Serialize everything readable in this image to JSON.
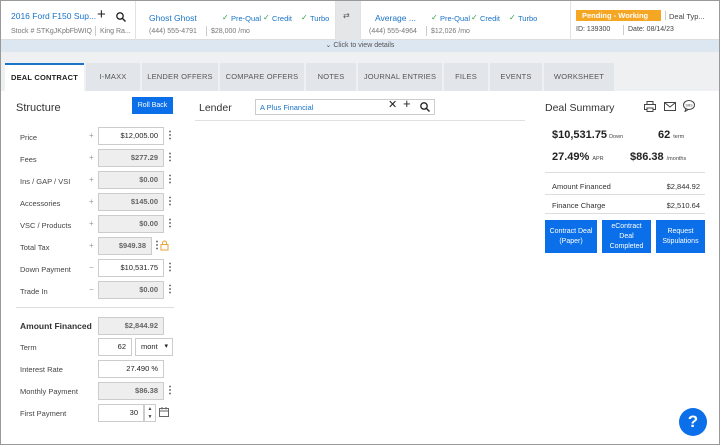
{
  "header": {
    "vehicle": {
      "title": "2016 Ford F150 Sup...",
      "stock": "Stock # STKgJKpbFbWIQ",
      "location": "King Ra..."
    },
    "buyer": {
      "name": "Ghost Ghost",
      "phone": "(444) 555-4791",
      "amount": "$28,000 /mo",
      "prequal": "Pre-Qual",
      "credit": "Credit",
      "turbo": "Turbo"
    },
    "cobuyer": {
      "name": "Average ...",
      "phone": "(444) 555-4964",
      "amount": "$12,026 /mo",
      "prequal": "Pre-Qual",
      "credit": "Credit",
      "turbo": "Turbo"
    },
    "status": {
      "badge": "Pending - Working Lead",
      "type": "Deal Typ...",
      "id": "ID: 139300",
      "date": "Date: 08/14/23"
    },
    "colors": {
      "badge": "#f5a623",
      "accent": "#1a73c8",
      "check": "#2e9e44"
    }
  },
  "view_details": "Click to view details",
  "tabs": [
    "DEAL CONTRACT",
    "I-MAXX",
    "LENDER OFFERS",
    "COMPARE OFFERS",
    "NOTES",
    "JOURNAL ENTRIES",
    "FILES",
    "EVENTS",
    "WORKSHEET"
  ],
  "structure": {
    "title": "Structure",
    "rollback": "Roll Back",
    "rows": [
      {
        "label": "Price",
        "value": "$12,005.00"
      },
      {
        "label": "Fees",
        "value": "$277.29"
      },
      {
        "label": "Ins / GAP / VSI",
        "value": "$0.00"
      },
      {
        "label": "Accessories",
        "value": "$145.00"
      },
      {
        "label": "VSC / Products",
        "value": "$0.00"
      },
      {
        "label": "Total Tax",
        "value": "$949.38"
      },
      {
        "label": "Down Payment",
        "value": "$10,531.75"
      },
      {
        "label": "Trade In",
        "value": "$0.00"
      }
    ],
    "amount_financed_label": "Amount Financed",
    "amount_financed": "$2,844.92",
    "term_label": "Term",
    "term": "62",
    "term_unit": "mont",
    "rate_label": "Interest Rate",
    "rate": "27.490 %",
    "monthly_label": "Monthly Payment",
    "monthly": "$86.38",
    "first_label": "First Payment",
    "first": "30"
  },
  "lender": {
    "title": "Lender",
    "value": "A Plus Financial"
  },
  "summary": {
    "title": "Deal Summary",
    "down": "$10,531.75",
    "down_label": "Down",
    "term": "62",
    "term_label": "term",
    "apr": "27.49%",
    "apr_label": "APR",
    "monthly": "$86.38",
    "monthly_label": "/months",
    "amount_financed_label": "Amount Financed",
    "amount_financed": "$2,844.92",
    "finance_charge_label": "Finance Charge",
    "finance_charge": "$2,510.64",
    "buttons": [
      "Contract Deal (Paper)",
      "eContract Deal Completed",
      "Request Stipulations"
    ]
  },
  "help": "?"
}
